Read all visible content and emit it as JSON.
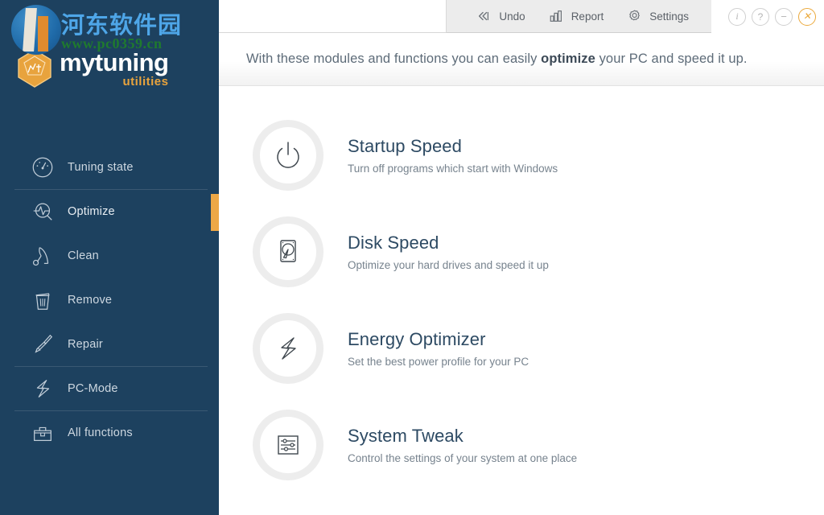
{
  "brand": {
    "name_main": "mytuning",
    "name_sub": "utilities",
    "logo_icon": "dodecahedron-logo"
  },
  "watermark": {
    "chinese_text": "河东软件园",
    "url_text": "www.pc0359.cn",
    "badge_icon": "watermark-badge-icon"
  },
  "sidebar": {
    "items": [
      {
        "label": "Tuning state",
        "icon": "gauge-icon",
        "active": false,
        "separator_above": false
      },
      {
        "label": "Optimize",
        "icon": "magnifier-pulse-icon",
        "active": true,
        "separator_above": true
      },
      {
        "label": "Clean",
        "icon": "vacuum-icon",
        "active": false,
        "separator_above": false
      },
      {
        "label": "Remove",
        "icon": "trash-icon",
        "active": false,
        "separator_above": false
      },
      {
        "label": "Repair",
        "icon": "screwdriver-icon",
        "active": false,
        "separator_above": false
      },
      {
        "label": "PC-Mode",
        "icon": "lightning-bolt-icon",
        "active": false,
        "separator_above": true
      },
      {
        "label": "All functions",
        "icon": "toolbox-icon",
        "active": false,
        "separator_above": true
      }
    ],
    "active_indicator_color": "#eda846",
    "background_color": "#1d415f"
  },
  "toolbar": {
    "buttons": [
      {
        "label": "Undo",
        "icon": "rewind-icon"
      },
      {
        "label": "Report",
        "icon": "bar-chart-icon"
      },
      {
        "label": "Settings",
        "icon": "gear-icon"
      }
    ]
  },
  "window_controls": [
    {
      "name": "info",
      "glyph": "i",
      "icon": "info-icon"
    },
    {
      "name": "help",
      "glyph": "?",
      "icon": "help-icon"
    },
    {
      "name": "minimize",
      "glyph": "−",
      "icon": "minimize-icon"
    },
    {
      "name": "close",
      "glyph": "✕",
      "icon": "close-icon",
      "color": "#eba93c"
    }
  ],
  "header": {
    "intro_before": "With these modules and functions you can easily ",
    "intro_bold": "optimize",
    "intro_after": " your PC and speed it up."
  },
  "modules": [
    {
      "title": "Startup Speed",
      "description": "Turn off programs which start with Windows",
      "icon": "power-icon"
    },
    {
      "title": "Disk Speed",
      "description": "Optimize your hard drives and speed it up",
      "icon": "hard-disk-icon"
    },
    {
      "title": "Energy Optimizer",
      "description": "Set the best power profile for your PC",
      "icon": "lightning-bolt-icon"
    },
    {
      "title": "System Tweak",
      "description": "Control the settings of your system at one place",
      "icon": "sliders-icon"
    }
  ]
}
